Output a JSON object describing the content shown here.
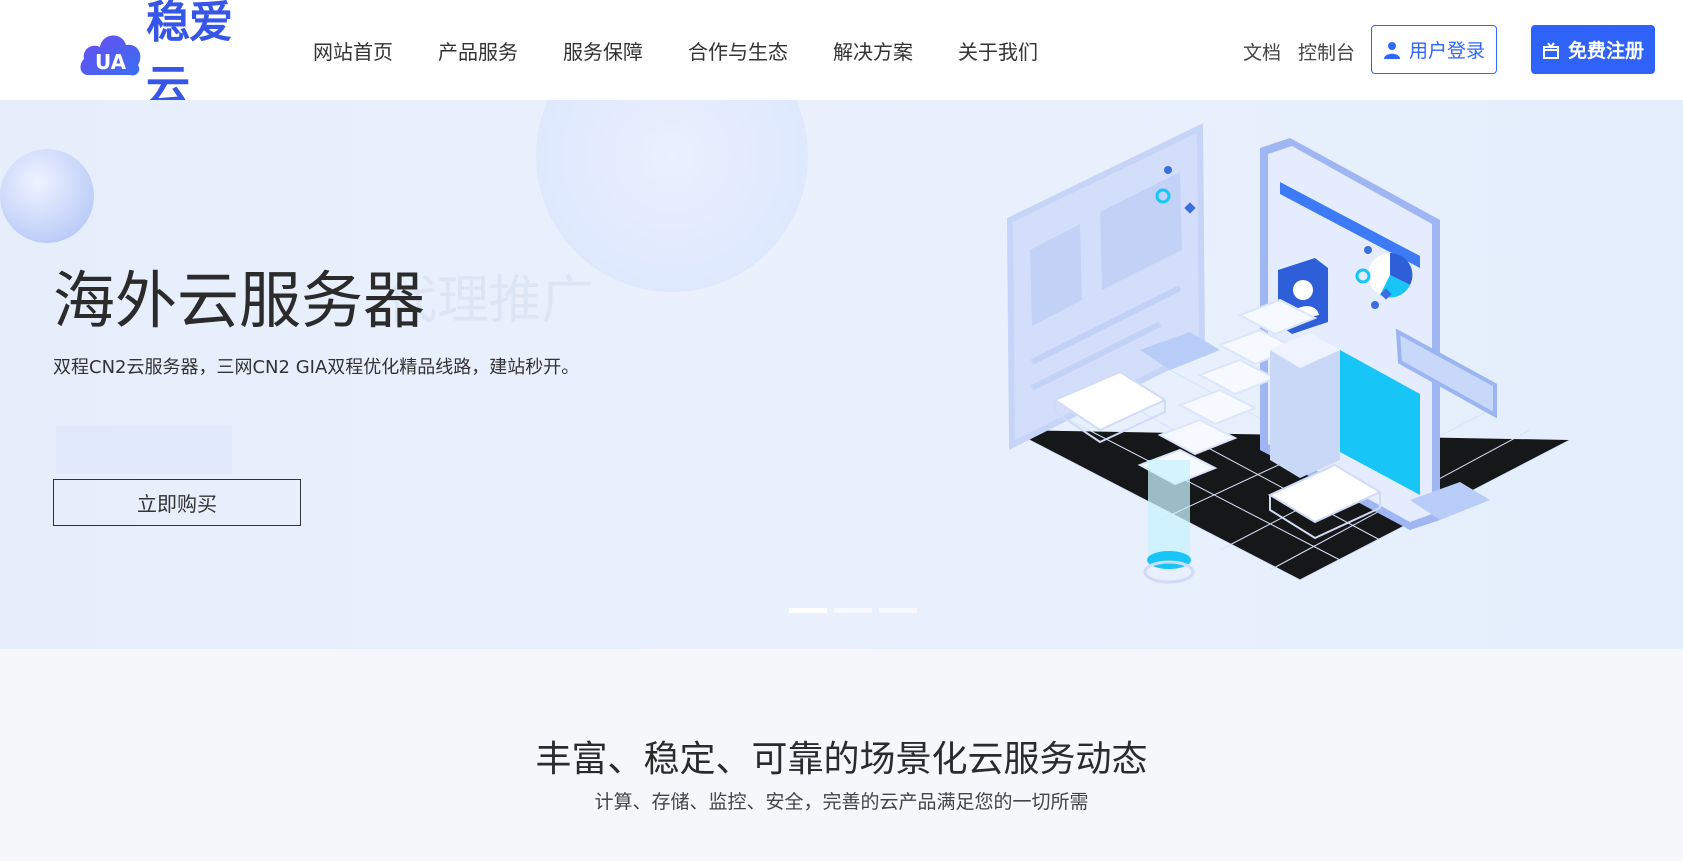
{
  "brand": {
    "logo_text": "稳爱云",
    "logo_mark": "UA",
    "accent": "#2e62f8"
  },
  "nav": [
    {
      "label": "网站首页"
    },
    {
      "label": "产品服务"
    },
    {
      "label": "服务保障"
    },
    {
      "label": "合作与生态"
    },
    {
      "label": "解决方案"
    },
    {
      "label": "关于我们"
    }
  ],
  "header": {
    "docs_label": "文档",
    "console_label": "控制台",
    "login_label": "用户登录",
    "register_label": "免费注册"
  },
  "hero": {
    "title": "海外云服务器",
    "ghost_title": "代理推广",
    "subtitle": "双程CN2云服务器，三网CN2 GIA双程优化精品线路，建站秒开。",
    "buy_label": "立即购买",
    "slides": 3,
    "active_slide": 1
  },
  "section": {
    "title": "丰富、稳定、可靠的场景化云服务动态",
    "subtitle": "计算、存储、监控、安全，完善的云产品满足您的一切所需"
  },
  "icons": [
    "user-icon",
    "gift-icon"
  ]
}
